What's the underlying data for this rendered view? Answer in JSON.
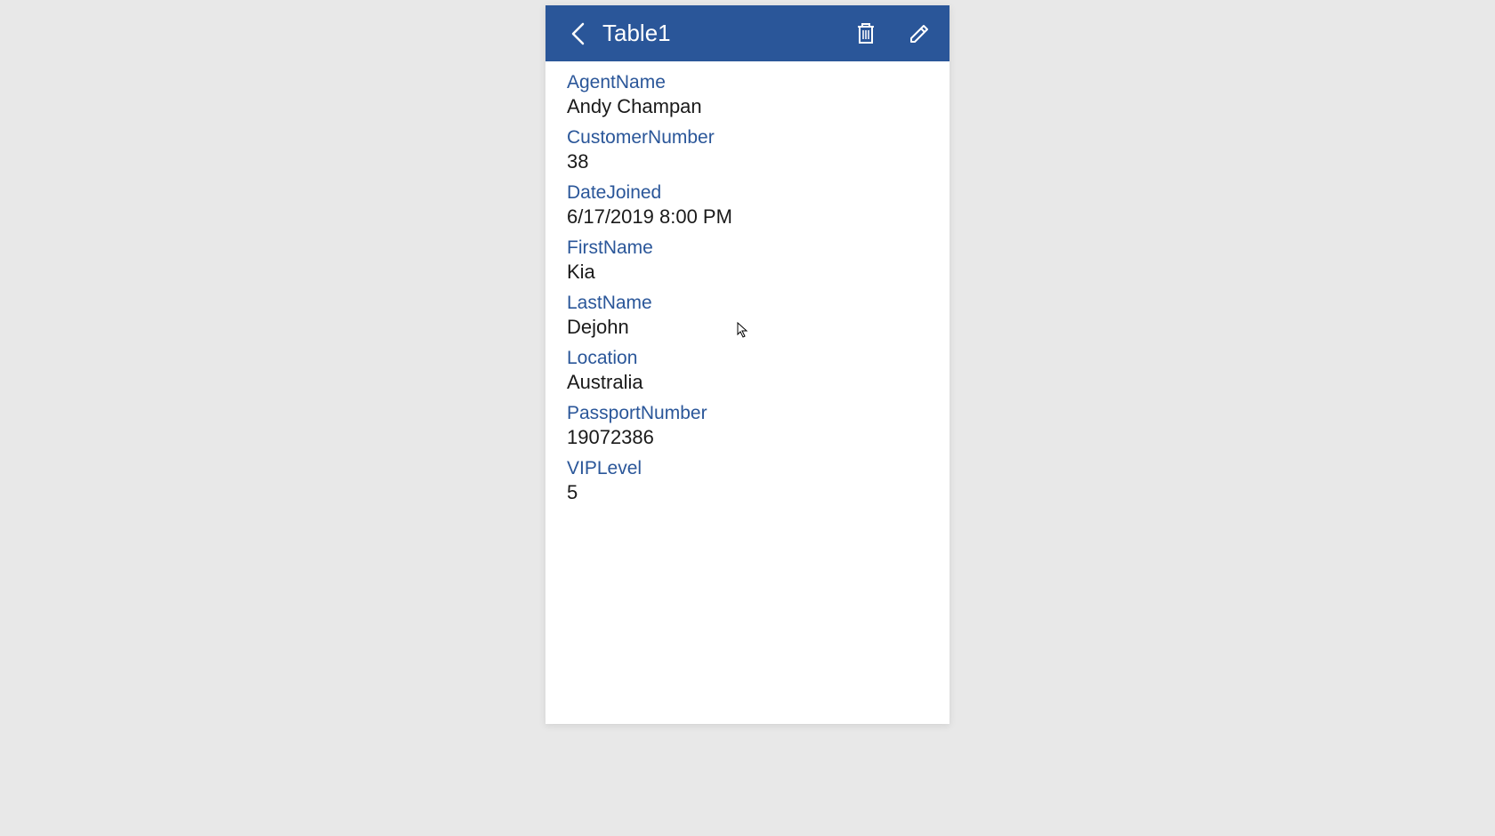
{
  "header": {
    "title": "Table1"
  },
  "fields": [
    {
      "label": "AgentName",
      "value": "Andy Champan"
    },
    {
      "label": "CustomerNumber",
      "value": "38"
    },
    {
      "label": "DateJoined",
      "value": "6/17/2019 8:00 PM"
    },
    {
      "label": "FirstName",
      "value": "Kia"
    },
    {
      "label": "LastName",
      "value": "Dejohn"
    },
    {
      "label": "Location",
      "value": "Australia"
    },
    {
      "label": "PassportNumber",
      "value": "19072386"
    },
    {
      "label": "VIPLevel",
      "value": "5"
    }
  ],
  "colors": {
    "headerBg": "#2a5699",
    "labelColor": "#2a5699",
    "valueColor": "#1a1a1a"
  }
}
